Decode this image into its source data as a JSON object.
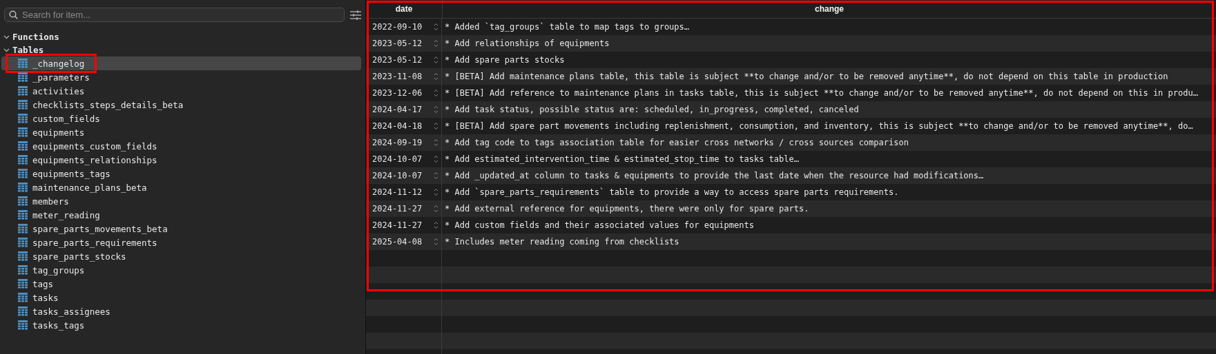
{
  "sidebar": {
    "search": {
      "placeholder": "Search for item..."
    },
    "groups": [
      {
        "label": "Functions",
        "expanded": true
      },
      {
        "label": "Tables",
        "expanded": true,
        "children": [
          {
            "label": "_changelog",
            "selected": true,
            "highlighted": true
          },
          {
            "label": "_parameters",
            "selected": false,
            "highlighted": false
          },
          {
            "label": "activities",
            "selected": false,
            "highlighted": false
          },
          {
            "label": "checklists_steps_details_beta",
            "selected": false,
            "highlighted": false
          },
          {
            "label": "custom_fields",
            "selected": false,
            "highlighted": false
          },
          {
            "label": "equipments",
            "selected": false,
            "highlighted": false
          },
          {
            "label": "equipments_custom_fields",
            "selected": false,
            "highlighted": false
          },
          {
            "label": "equipments_relationships",
            "selected": false,
            "highlighted": false
          },
          {
            "label": "equipments_tags",
            "selected": false,
            "highlighted": false
          },
          {
            "label": "maintenance_plans_beta",
            "selected": false,
            "highlighted": false
          },
          {
            "label": "members",
            "selected": false,
            "highlighted": false
          },
          {
            "label": "meter_reading",
            "selected": false,
            "highlighted": false
          },
          {
            "label": "spare_parts_movements_beta",
            "selected": false,
            "highlighted": false
          },
          {
            "label": "spare_parts_requirements",
            "selected": false,
            "highlighted": false
          },
          {
            "label": "spare_parts_stocks",
            "selected": false,
            "highlighted": false
          },
          {
            "label": "tag_groups",
            "selected": false,
            "highlighted": false
          },
          {
            "label": "tags",
            "selected": false,
            "highlighted": false
          },
          {
            "label": "tasks",
            "selected": false,
            "highlighted": false
          },
          {
            "label": "tasks_assignees",
            "selected": false,
            "highlighted": false
          },
          {
            "label": "tasks_tags",
            "selected": false,
            "highlighted": false
          }
        ]
      }
    ]
  },
  "table": {
    "highlighted": true,
    "columns": [
      "date",
      "change"
    ],
    "rows": [
      [
        "2022-09-10",
        "* Added `tag_groups` table to map tags to groups…"
      ],
      [
        "2023-05-12",
        "* Add relationships of equipments"
      ],
      [
        "2023-05-12",
        "* Add spare parts stocks"
      ],
      [
        "2023-11-08",
        "* [BETA] Add maintenance plans table, this table is subject **to change and/or to be removed anytime**, do not depend on this table in production"
      ],
      [
        "2023-12-06",
        "* [BETA] Add reference to maintenance plans in tasks table, this is subject **to change and/or to be removed anytime**, do not depend on this in produ…"
      ],
      [
        "2024-04-17",
        "* Add task status, possible status are: scheduled, in_progress, completed, canceled"
      ],
      [
        "2024-04-18",
        "* [BETA] Add spare part movements including replenishment, consumption, and inventory, this is subject **to change and/or to be removed anytime**, do…"
      ],
      [
        "2024-09-19",
        "* Add tag code to tags association table for easier cross networks / cross sources comparison"
      ],
      [
        "2024-10-07",
        "* Add estimated_intervention_time & estimated_stop_time to tasks table…"
      ],
      [
        "2024-10-07",
        "* Add _updated_at column to tasks & equipments to provide the last date when the resource had modifications…"
      ],
      [
        "2024-11-12",
        "* Add `spare_parts_requirements` table to provide a way to access spare parts requirements."
      ],
      [
        "2024-11-27",
        "* Add external reference for equipments, there were only for spare parts."
      ],
      [
        "2024-11-27",
        "* Add custom fields and their associated values for equipments"
      ],
      [
        "2025-04-08",
        "* Includes meter reading coming from checklists"
      ]
    ]
  }
}
